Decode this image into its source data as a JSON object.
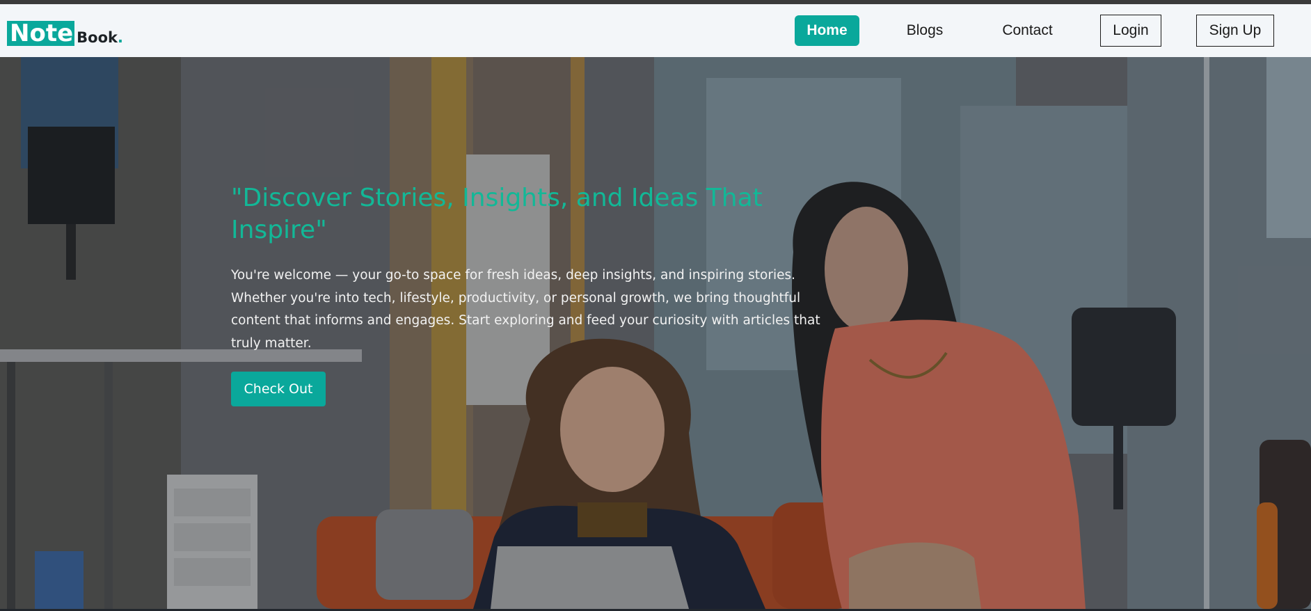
{
  "logo": {
    "primary": "Note",
    "secondary": "Book",
    "dot": "."
  },
  "nav": {
    "home": "Home",
    "blogs": "Blogs",
    "contact": "Contact",
    "login": "Login",
    "signup": "Sign Up"
  },
  "hero": {
    "title": "\"Discover Stories, Insights, and Ideas That Inspire\"",
    "text": "You're welcome — your go-to space for fresh ideas, deep insights, and inspiring stories. Whether you're into tech, lifestyle, productivity, or personal growth, we bring thoughtful content that informs and engages. Start exploring and feed your curiosity with articles that truly matter.",
    "button": "Check Out"
  },
  "colors": {
    "accent": "#0aa89b",
    "title": "#12b897",
    "navbar_bg": "#f3f6f9"
  }
}
